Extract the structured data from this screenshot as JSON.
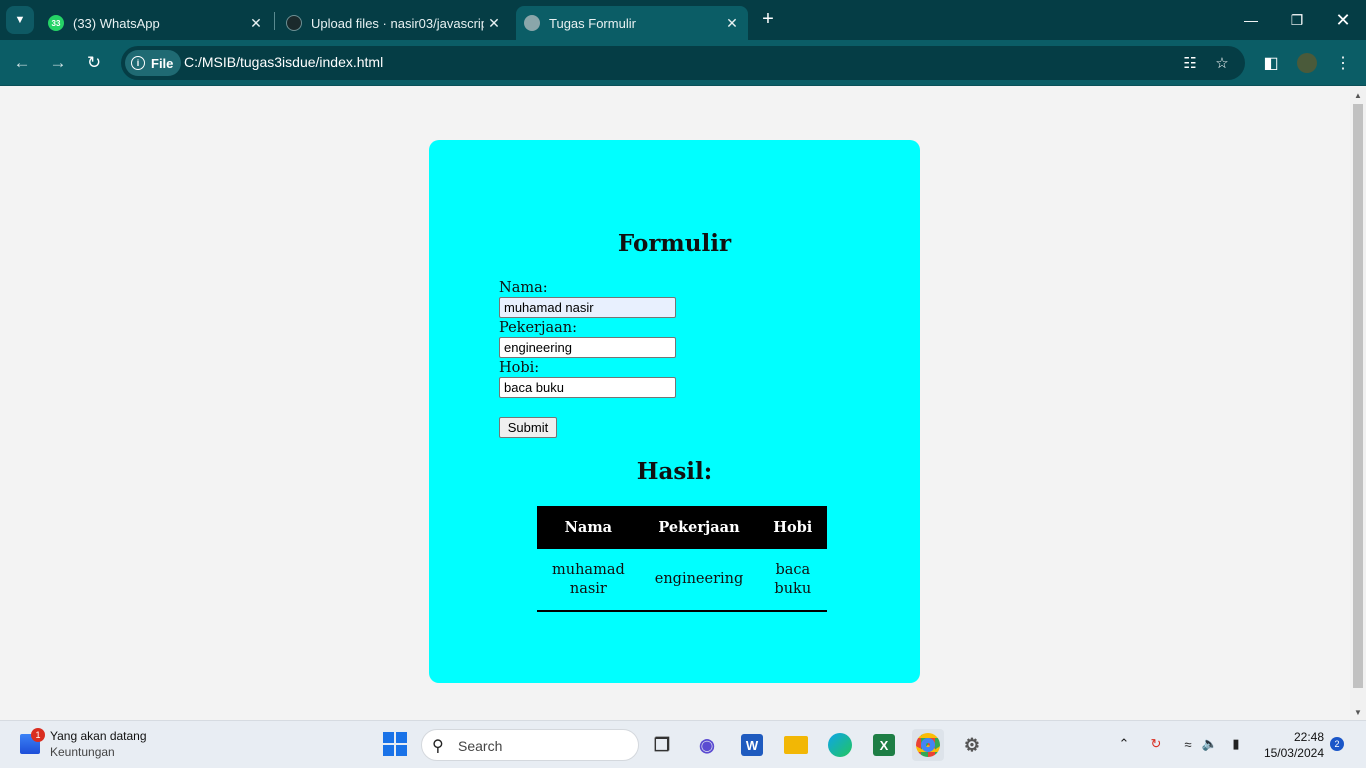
{
  "tabs": [
    {
      "title": "(33) WhatsApp",
      "badge": "33"
    },
    {
      "title": "Upload files · nasir03/javascript..."
    },
    {
      "title": "Tugas Formulir"
    }
  ],
  "address": {
    "scheme_label": "File",
    "url": "C:/MSIB/tugas3isdue/index.html"
  },
  "form": {
    "title": "Formulir",
    "nama_label": "Nama:",
    "nama_value": "muhamad nasir",
    "pekerjaan_label": "Pekerjaan:",
    "pekerjaan_value": "engineering",
    "hobi_label": "Hobi:",
    "hobi_value": "baca buku",
    "submit_label": "Submit"
  },
  "result": {
    "title": "Hasil:",
    "headers": [
      "Nama",
      "Pekerjaan",
      "Hobi"
    ],
    "rows": [
      [
        "muhamad nasir",
        "engineering",
        "baca buku"
      ]
    ]
  },
  "taskbar": {
    "widget_title": "Yang akan datang",
    "widget_subtitle": "Keuntungan",
    "widget_badge": "1",
    "search_placeholder": "Search",
    "time": "22:48",
    "date": "15/03/2024",
    "notification_count": "2"
  },
  "colors": {
    "card_background": "#00ffff",
    "browser_frame": "#0b5d66",
    "table_header": "#000000"
  }
}
